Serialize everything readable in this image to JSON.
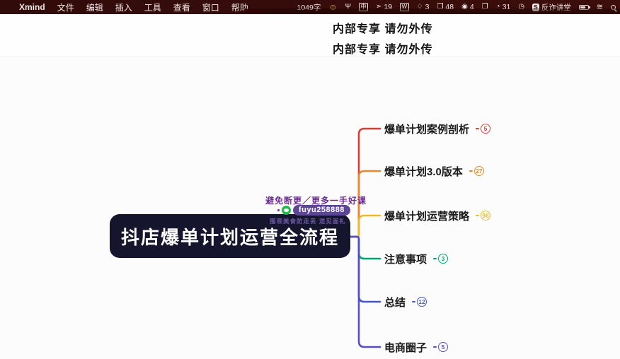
{
  "menu_bar": {
    "apple_logo": "",
    "app_name": "Xmind",
    "menus": [
      "文件",
      "编辑",
      "插入",
      "工具",
      "查看",
      "窗口",
      "帮助"
    ],
    "status": {
      "word_count": "1049字",
      "smiley_glyph": "☺",
      "mic_glyph": "Ψ",
      "input_method": "中",
      "bird_glyph": "➣",
      "bird_count": "19",
      "w_label": "W",
      "tag_glyph": "♢",
      "tag_count": "3",
      "bookmark_glyph": "❒",
      "bookmark_count": "48",
      "coins_glyph": "◉",
      "coins_count": "4",
      "folder_glyph": "❐",
      "gauge_glyph": "◔",
      "gauge_count": "31",
      "clock_glyph": "◷",
      "s_app_label": "S",
      "s_app_text": "反诈讲堂",
      "wifi_glyph": "≋"
    }
  },
  "confidential_banner": {
    "line1": "内部专享 请勿外传",
    "line2": "内部专享 请勿外传"
  },
  "seller_watermark": {
    "line1": "避免断更／更多一手好课",
    "wechat_id": "fuyu258888",
    "line3": "围观美食防走丢 送见面礼"
  },
  "mindmap": {
    "root": "抖店爆单计划运营全流程",
    "branches": [
      {
        "label": "爆单计划案例剖析",
        "count": "5",
        "color": "#e03c31"
      },
      {
        "label": "爆单计划3.0版本",
        "count": "27",
        "color": "#e8872e"
      },
      {
        "label": "爆单计划运营策略",
        "count": "98",
        "color": "#e5bd2e"
      },
      {
        "label": "注意事项",
        "count": "3",
        "color": "#00a76d"
      },
      {
        "label": "总结",
        "count": "12",
        "color": "#4656c9"
      },
      {
        "label": "电商圈子",
        "count": "5",
        "color": "#584dc4"
      }
    ]
  }
}
